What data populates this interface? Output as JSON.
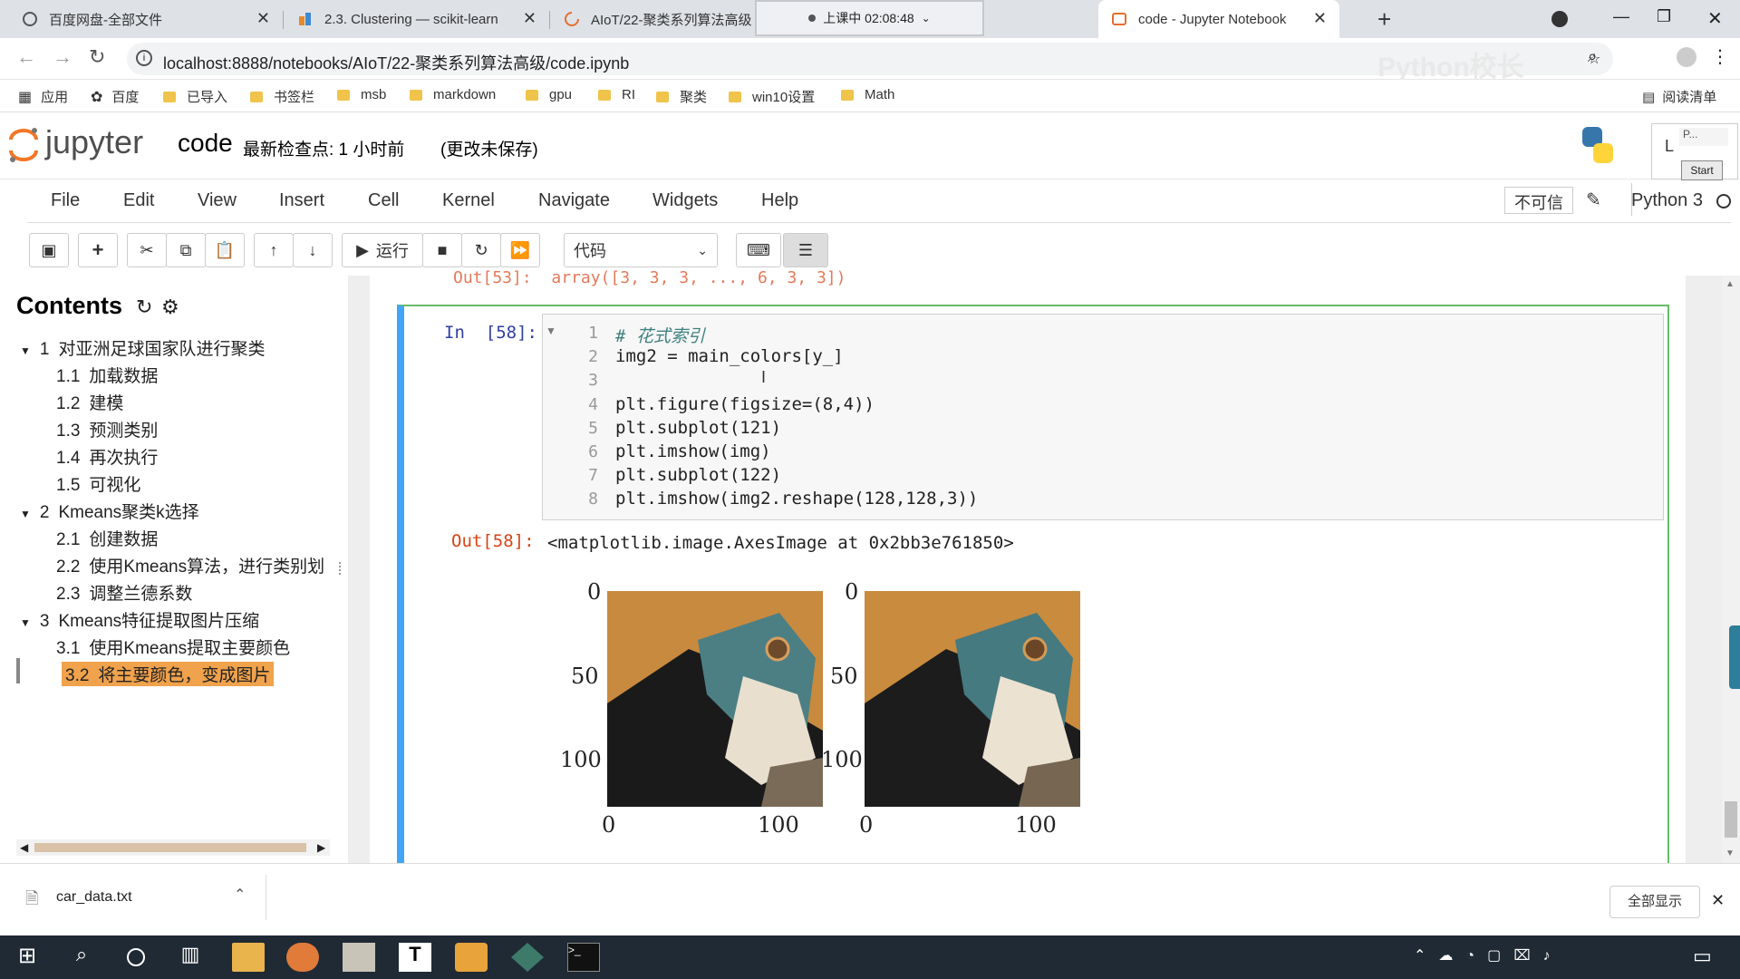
{
  "browser": {
    "tabs": [
      {
        "title": "百度网盘-全部文件"
      },
      {
        "title": "2.3. Clustering — scikit-learn"
      },
      {
        "title": "AIoT/22-聚类系列算法高级"
      },
      {
        "title": "code - Jupyter Notebook"
      }
    ],
    "recording": "上课中 02:08:48",
    "url": "localhost:8888/notebooks/AIoT/22-聚类系列算法高级/code.ipynb",
    "watermark": "Python校长",
    "bookmarks": [
      "应用",
      "百度",
      "已导入",
      "书签栏",
      "msb",
      "markdown",
      "gpu",
      "RI",
      "聚类",
      "win10设置",
      "Math"
    ],
    "reading_list": "阅读清单"
  },
  "jupyter": {
    "logo": "jupyter",
    "notebook_name": "code",
    "checkpoint": "最新检查点: 1 小时前",
    "unsaved": "(更改未保存)",
    "menus": [
      "File",
      "Edit",
      "View",
      "Insert",
      "Cell",
      "Kernel",
      "Navigate",
      "Widgets",
      "Help"
    ],
    "trusted": "不可信",
    "kernel": "Python 3",
    "run_label": "运行",
    "cell_type": "代码",
    "start_popup": "Start",
    "popup_text": "P..."
  },
  "toc": {
    "title": "Contents",
    "items": [
      {
        "num": "1",
        "label": "对亚洲足球国家队进行聚类",
        "level": 1
      },
      {
        "num": "1.1",
        "label": "加载数据",
        "level": 2
      },
      {
        "num": "1.2",
        "label": "建模",
        "level": 2
      },
      {
        "num": "1.3",
        "label": "预测类别",
        "level": 2
      },
      {
        "num": "1.4",
        "label": "再次执行",
        "level": 2
      },
      {
        "num": "1.5",
        "label": "可视化",
        "level": 2
      },
      {
        "num": "2",
        "label": "Kmeans聚类k选择",
        "level": 1
      },
      {
        "num": "2.1",
        "label": "创建数据",
        "level": 2
      },
      {
        "num": "2.2",
        "label": "使用Kmeans算法，进行类别划",
        "level": 2
      },
      {
        "num": "2.3",
        "label": "调整兰德系数",
        "level": 2
      },
      {
        "num": "3",
        "label": "Kmeans特征提取图片压缩",
        "level": 1
      },
      {
        "num": "3.1",
        "label": "使用Kmeans提取主要颜色",
        "level": 2
      },
      {
        "num": "3.2",
        "label": "将主要颜色，变成图片",
        "level": 2
      }
    ]
  },
  "notebook": {
    "prev_output": "Out[53]:  array([3, 3, 3, ..., 6, 3, 3])",
    "in_prompt": "In  [58]:",
    "code_lines": [
      {
        "n": "1",
        "text": "# 花式索引"
      },
      {
        "n": "2",
        "text": "img2 = main_colors[y_]"
      },
      {
        "n": "3",
        "text": ""
      },
      {
        "n": "4",
        "text": "plt.figure(figsize=(8,4))"
      },
      {
        "n": "5",
        "text": "plt.subplot(121)"
      },
      {
        "n": "6",
        "text": "plt.imshow(img)"
      },
      {
        "n": "7",
        "text": "plt.subplot(122)"
      },
      {
        "n": "8",
        "text": "plt.imshow(img2.reshape(128,128,3))"
      }
    ],
    "out_prompt": "Out[58]:",
    "out_text": "<matplotlib.image.AxesImage at 0x2bb3e761850>",
    "plot_ticks_y": [
      "0",
      "50",
      "100"
    ],
    "plot_ticks_x": [
      "0",
      "100"
    ]
  },
  "downloads": {
    "file": "car_data.txt",
    "show_all": "全部显示"
  }
}
